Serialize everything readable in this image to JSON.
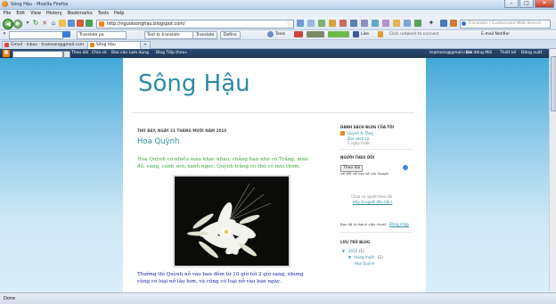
{
  "window": {
    "title": "Sông Hậu - Mozilla Firefox"
  },
  "menu": [
    "File",
    "Edit",
    "View",
    "History",
    "Bookmarks",
    "Tools",
    "Help"
  ],
  "address": {
    "url": "http://nguoisonghau.blogspot.com/"
  },
  "search": {
    "placeholder": "Translator / Customized Web Search"
  },
  "toolbar2": {
    "translate_select": "Translate pa",
    "text_input": "Text to translate",
    "translate_btn": "Translate",
    "define_btn": "Define",
    "tools": "Tools",
    "like": "Like",
    "click_connect": "Click network to connect",
    "email_notifier": "E-mail Notifier"
  },
  "tabs": [
    {
      "label": "Gmail - Inbox - tnamson@gmail.com"
    },
    {
      "label": "Sông Hậu"
    }
  ],
  "blogger_nav": {
    "left": [
      "Theo dõi",
      "Chia sẻ",
      "Báo cáo Lạm dụng",
      "Blog Tiếp theo»"
    ],
    "email": "tnamson@gmail.com",
    "right": [
      "Bài đăng Mới",
      "Thiết kế",
      "Đăng xuất"
    ]
  },
  "blog": {
    "title": "Sông Hậu",
    "date": "THỨ BẢY, NGÀY 21 THÁNG MƯỜI NĂM 2010",
    "post_title": "Hoa Quỳnh",
    "para1": "Hoa Quỳnh có nhiều màu khác nhau, chẳng hạn như có Trắng, màu đỏ, vàng, cánh sen, xanh ngọc. Quỳnh trắng có thứ có mùi thơm.",
    "para2": "Thường thì Quỳnh nở vào ban đêm từ 10 giờ tới 2 giờ sang, nhưng cũng có loại nở lâu hơn, và cũng có loại nở vào ban ngày."
  },
  "sidebar": {
    "blog_list_title": "DANH SÁCH BLOG CỦA TÔI",
    "blog_name": "Huynh Ái Tông",
    "blog_sub": "Đọc sách cũ",
    "blog_time": "5 ngày trước",
    "followers_title": "NGƯỜI THEO DÕI",
    "follow_btn": "Theo dõi",
    "follow_sub": "với Kết nối bạn bè của Google",
    "no_followers": "Chưa có người theo dõi",
    "first_follower": "Hãy là người đầu tiên!",
    "member_q": "Bạn đã là thành viên chưa?",
    "signin": "Đăng nhập",
    "archive_title": "LƯU TRỮ BLOG",
    "year": "2010",
    "year_count": "(1)",
    "month": "tháng mười",
    "month_count": "(1)",
    "post": "Hoa Quỳnh"
  },
  "status": {
    "text": "Done"
  }
}
